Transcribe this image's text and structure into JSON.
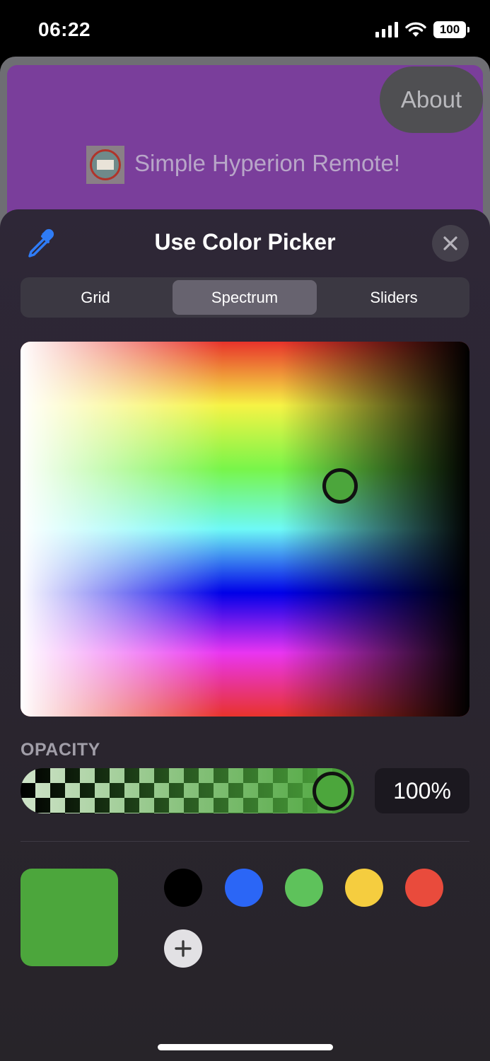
{
  "status_bar": {
    "time": "06:22",
    "battery": "100"
  },
  "app": {
    "about_label": "About",
    "title": "Simple Hyperion Remote!"
  },
  "picker": {
    "title": "Use Color Picker",
    "tabs": [
      {
        "label": "Grid"
      },
      {
        "label": "Spectrum",
        "selected": true
      },
      {
        "label": "Sliders"
      }
    ],
    "selected_color": "#4ca63c",
    "opacity_label": "OPACITY",
    "opacity_value": "100%",
    "opacity_level": 1.0,
    "saved_swatches": [
      "#000000",
      "#2b66f6",
      "#5ec25b",
      "#f5cd3f",
      "#e94b3c"
    ]
  }
}
